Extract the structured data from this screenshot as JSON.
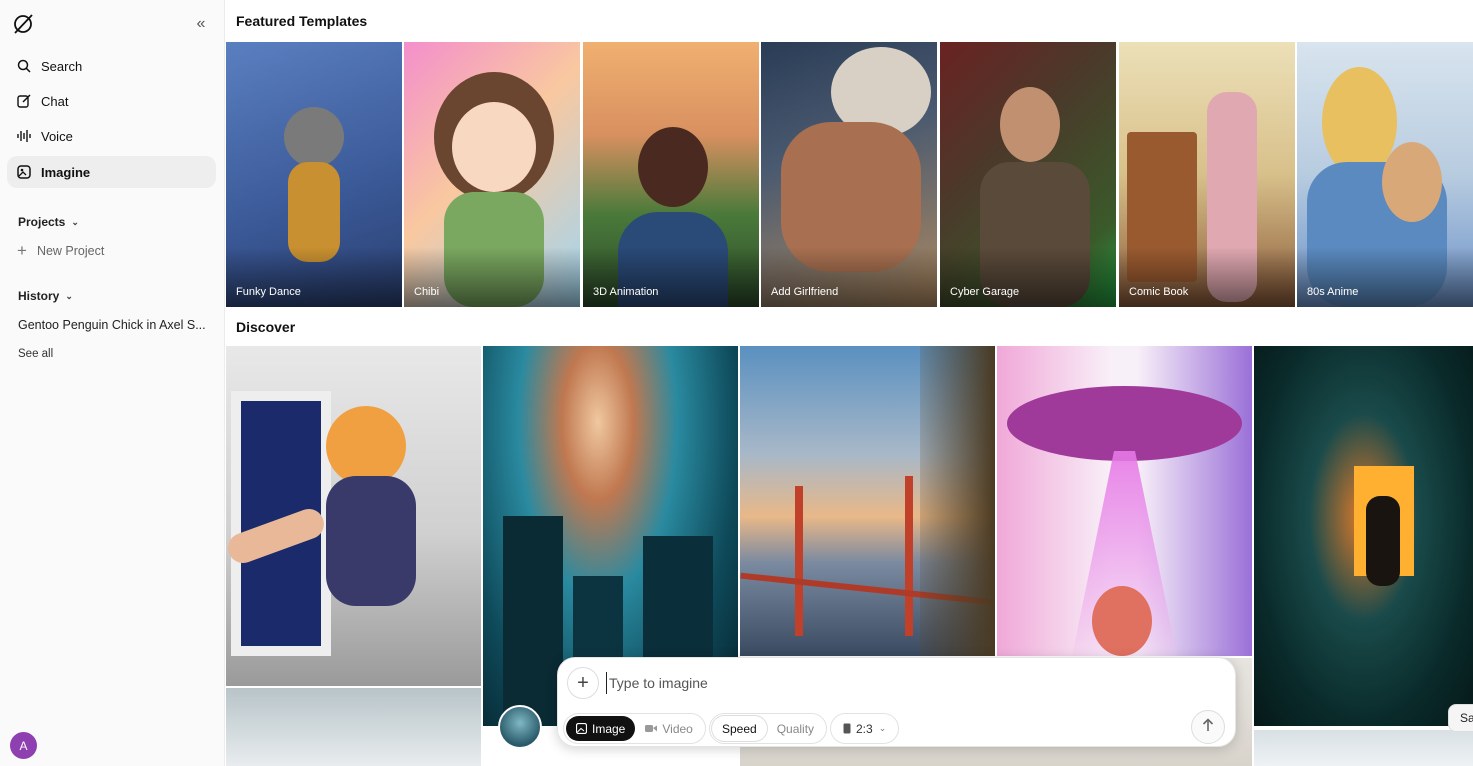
{
  "sidebar": {
    "nav": [
      {
        "label": "Search",
        "icon": "search-icon"
      },
      {
        "label": "Chat",
        "icon": "edit-icon"
      },
      {
        "label": "Voice",
        "icon": "voice-wave-icon"
      },
      {
        "label": "Imagine",
        "icon": "imagine-icon",
        "active": true
      }
    ],
    "projects_label": "Projects",
    "new_project_label": "New Project",
    "history_label": "History",
    "history_items": [
      "Gentoo Penguin Chick in Axel S..."
    ],
    "see_all_label": "See all",
    "avatar_initial": "A"
  },
  "main": {
    "featured_title": "Featured Templates",
    "templates": [
      {
        "label": "Funky Dance",
        "colors": [
          "#4a6ca8",
          "#2c4476"
        ]
      },
      {
        "label": "Chibi",
        "colors": [
          "#f38ac8",
          "#9fd4f0"
        ]
      },
      {
        "label": "3D Animation",
        "colors": [
          "#e8a06a",
          "#3e6a3a"
        ]
      },
      {
        "label": "Add Girlfriend",
        "colors": [
          "#2a3c56",
          "#b88a5a"
        ]
      },
      {
        "label": "Cyber Garage",
        "colors": [
          "#5c2a2a",
          "#3a4a2a"
        ]
      },
      {
        "label": "Comic Book",
        "colors": [
          "#e8d8a8",
          "#8a5a3a"
        ]
      },
      {
        "label": "80s Anime",
        "colors": [
          "#c8d8e8",
          "#5a8ac8"
        ]
      }
    ],
    "discover_title": "Discover"
  },
  "composer": {
    "placeholder": "Type to imagine",
    "image_label": "Image",
    "video_label": "Video",
    "speed_label": "Speed",
    "quality_label": "Quality",
    "aspect_label": "2:3"
  },
  "save_label": "Sa"
}
